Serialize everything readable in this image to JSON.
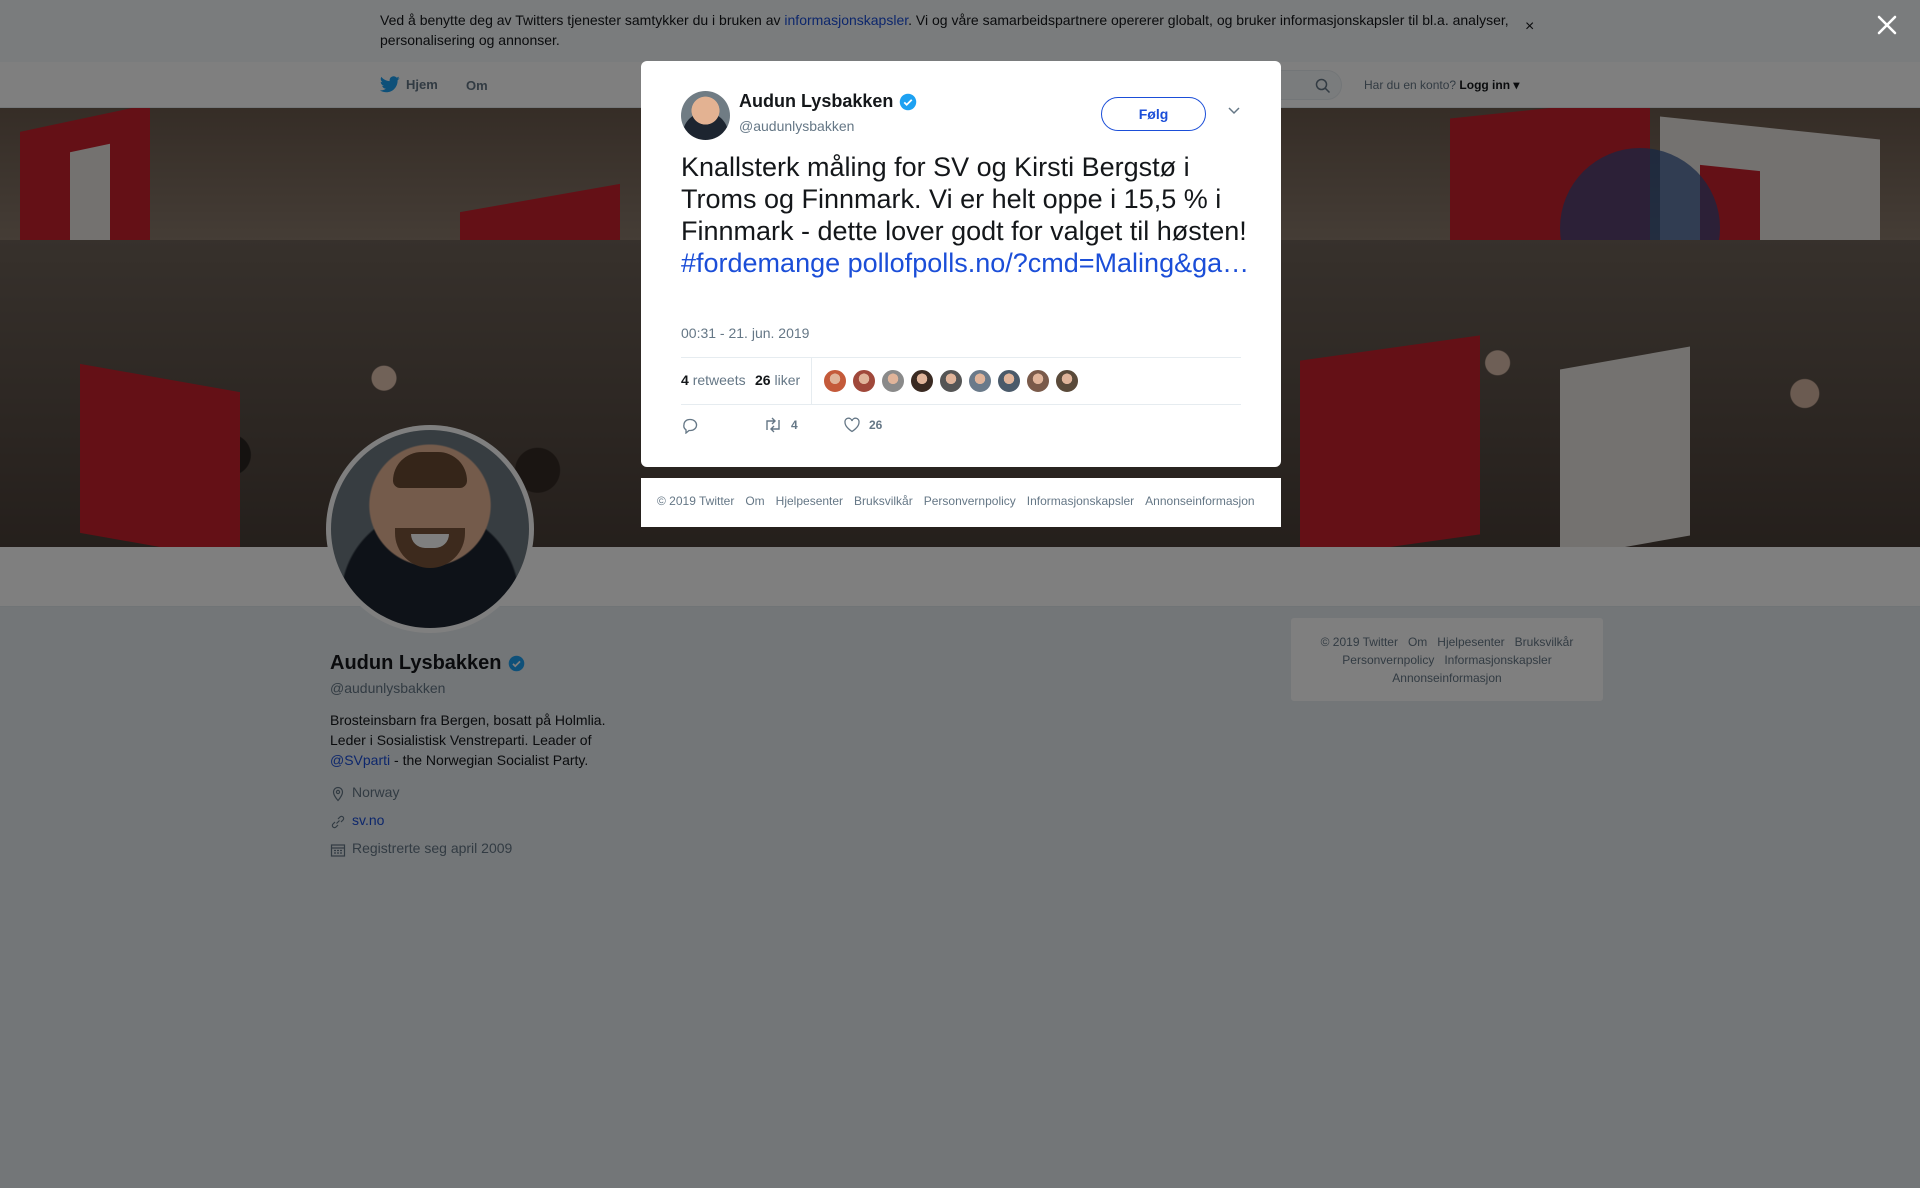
{
  "cookie_banner": {
    "text_before": "Ved å benytte deg av Twitters tjenester samtykker du i bruken av ",
    "link": "informasjonskapsler",
    "text_after": ". Vi og våre samarbeidspartnere opererer globalt, og bruker informasjonskapsler til bl.a. analyser, personalisering og annonser.",
    "close": "×"
  },
  "nav": {
    "home": "Hjem",
    "about": "Om",
    "account_prompt": "Har du en konto?",
    "login": "Logg inn"
  },
  "profile": {
    "name": "Audun Lysbakken",
    "handle": "@audunlysbakken",
    "bio_line1": "Brosteinsbarn fra Bergen, bosatt på Holmlia.",
    "bio_line2": "Leder i Sosialistisk Venstreparti. Leader of",
    "bio_mention": "@SVparti",
    "bio_rest": " - the Norwegian Socialist Party.",
    "location": "Norway",
    "website": "sv.no",
    "joined": "Registrerte seg april 2009"
  },
  "side_footer": {
    "items": [
      "© 2019 Twitter",
      "Om",
      "Hjelpesenter",
      "Bruksvilkår",
      "Personvernpolicy",
      "Informasjonskapsler",
      "Annonseinformasjon"
    ]
  },
  "tweet": {
    "name": "Audun Lysbakken",
    "handle": "@audunlysbakken",
    "follow": "Følg",
    "text": "Knallsterk måling for SV og Kirsti Bergstø i Troms og Finnmark. Vi er helt oppe i 15,5 % i Finnmark - dette lover godt for valget til høsten! ",
    "hashtag": "#fordemange",
    "link": "pollofpolls.no/?cmd=Maling&ga…",
    "timestamp": "00:31 - 21. jun. 2019",
    "retweets_count": "4",
    "retweets_label": "retweets",
    "likes_count": "26",
    "likes_label": "liker",
    "action_retweets": "4",
    "action_likes": "26",
    "liker_avatar_colors": [
      "#c45a3a",
      "#a0483a",
      "#8a8a8a",
      "#3a2a22",
      "#555555",
      "#6a7a8a",
      "#4a5a6a",
      "#7a5a4a",
      "#5a4a3a"
    ]
  },
  "modal_footer": {
    "items": [
      "© 2019 Twitter",
      "Om",
      "Hjelpesenter",
      "Bruksvilkår",
      "Personvernpolicy",
      "Informasjonskapsler",
      "Annonseinformasjon"
    ]
  },
  "colors": {
    "link": "#1b4ed8",
    "verified": "#1da1f2",
    "muted": "#657786"
  }
}
